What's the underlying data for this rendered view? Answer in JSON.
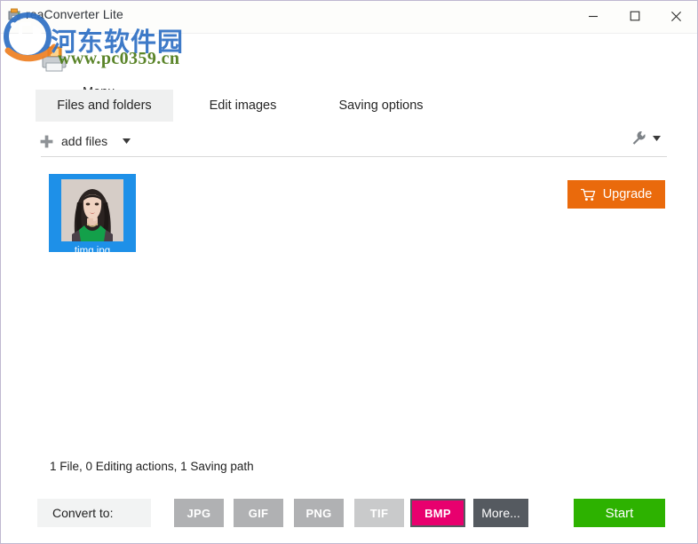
{
  "window": {
    "title": "reaConverter Lite",
    "app_icon": "printer-window-icon",
    "controls": {
      "minimize": "minimize-icon",
      "maximize": "maximize-icon",
      "close": "close-icon"
    }
  },
  "menubar": {
    "menu_label": "Menu",
    "caret": "chevron-down-icon",
    "printer_icon": "printer-icon"
  },
  "watermark": {
    "chinese_text": "河东软件园",
    "url_text": "www.pc0359.cn",
    "logo": "pc0359-logo"
  },
  "tabs": [
    {
      "id": "files",
      "label": "Files and folders",
      "active": true
    },
    {
      "id": "edit",
      "label": "Edit images",
      "active": false
    },
    {
      "id": "saving",
      "label": "Saving options",
      "active": false
    }
  ],
  "upgrade": {
    "label": "Upgrade",
    "icon": "shopping-cart-icon",
    "color": "#ea6a0c"
  },
  "toolbar": {
    "add_files_label": "add files",
    "add_files_icon": "plus-icon",
    "add_files_caret": "chevron-down-icon",
    "tools_icon": "wrench-icon",
    "tools_caret": "chevron-down-icon"
  },
  "file_list": {
    "items": [
      {
        "name": "timg.jpg",
        "selected": true,
        "thumbnail": "portrait-photo-thumbnail"
      }
    ]
  },
  "status": {
    "text": "1 File, 0 Editing actions, 1 Saving path"
  },
  "bottom": {
    "convert_to_label": "Convert to:",
    "formats": [
      {
        "id": "jpg",
        "label": "JPG",
        "selected": false,
        "color": "#b0b1b3"
      },
      {
        "id": "gif",
        "label": "GIF",
        "selected": false,
        "color": "#b0b1b3"
      },
      {
        "id": "png",
        "label": "PNG",
        "selected": false,
        "color": "#b0b1b3"
      },
      {
        "id": "tif",
        "label": "TIF",
        "selected": false,
        "color": "#c9cacb"
      },
      {
        "id": "bmp",
        "label": "BMP",
        "selected": true,
        "color": "#e8006e"
      },
      {
        "id": "more",
        "label": "More...",
        "selected": false,
        "color": "#555a60"
      }
    ],
    "start_label": "Start",
    "start_color": "#2db200"
  }
}
